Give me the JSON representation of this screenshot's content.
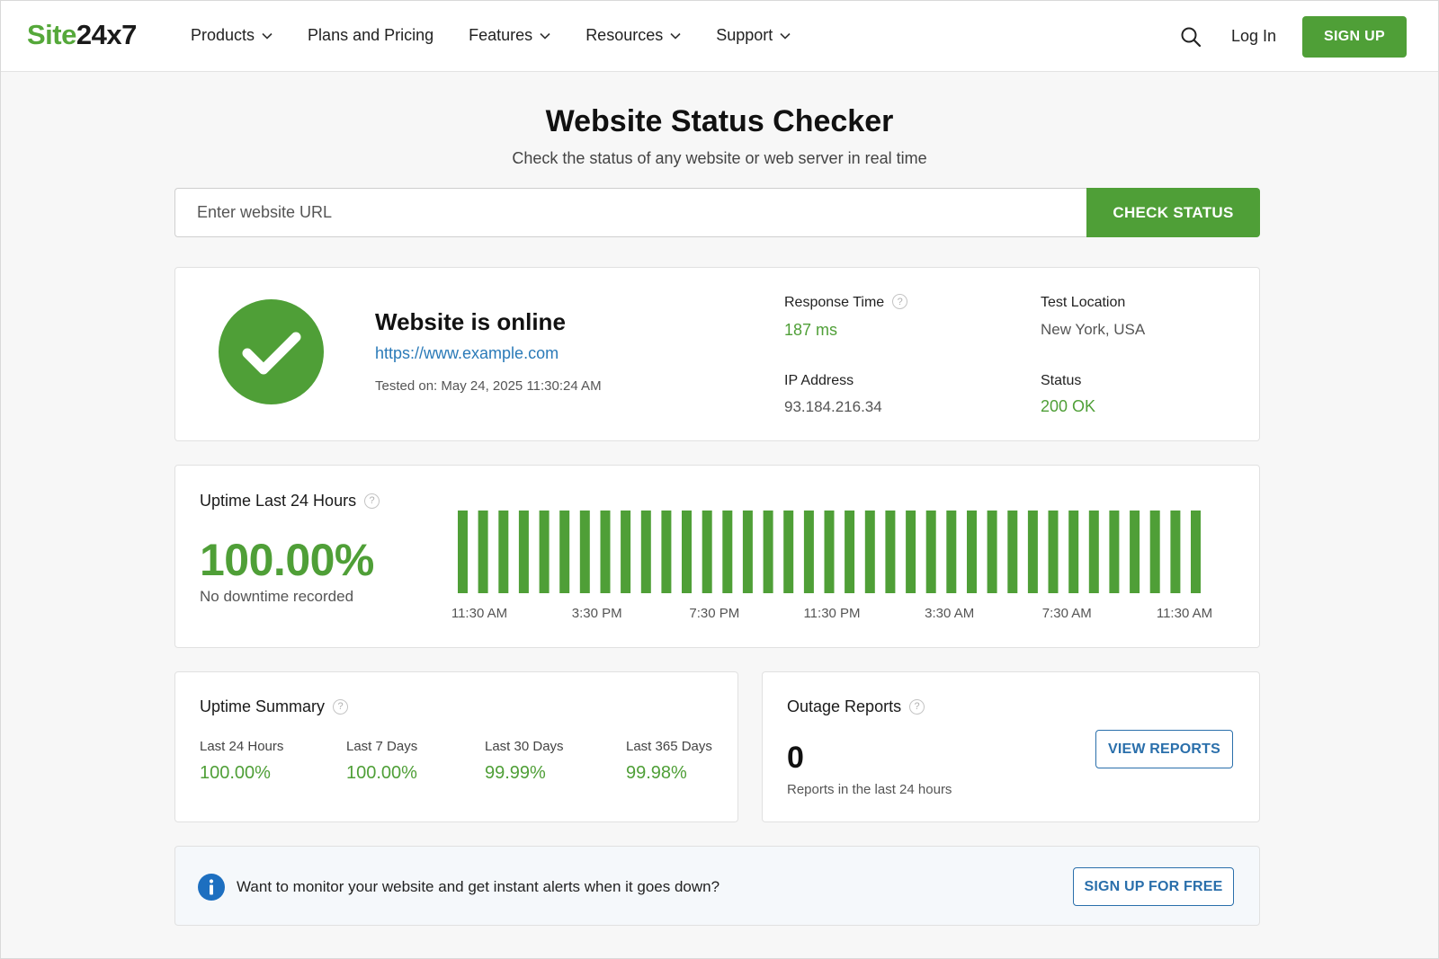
{
  "brand": {
    "logo_part1": "Site",
    "logo_part2": "24x7",
    "accent_color": "#4f9f37",
    "link_color": "#2a7ab8"
  },
  "nav": {
    "items": [
      {
        "label": "Products",
        "has_dropdown": true
      },
      {
        "label": "Plans and Pricing",
        "has_dropdown": false
      },
      {
        "label": "Features",
        "has_dropdown": true
      },
      {
        "label": "Resources",
        "has_dropdown": true
      },
      {
        "label": "Support",
        "has_dropdown": true
      }
    ],
    "search_icon": "search-icon",
    "login_label": "Log In",
    "signup_label": "SIGN UP"
  },
  "hero": {
    "title": "Website Status Checker",
    "subtitle": "Check the status of any website or web server in real time",
    "input_placeholder": "Enter website URL",
    "input_value": "",
    "button_label": "CHECK STATUS"
  },
  "status": {
    "icon": "check-circle-icon",
    "title": "Website is online",
    "url": "https://www.example.com",
    "tested_on": "Tested on: May 24, 2025 11:30:24 AM",
    "response_time_label": "Response Time",
    "response_time_value": "187 ms",
    "test_location_label": "Test Location",
    "test_location_value": "New York, USA",
    "ip_label": "IP Address",
    "ip_value": "93.184.216.34",
    "status_label": "Status",
    "status_value": "200 OK"
  },
  "uptime24": {
    "title": "Uptime Last 24 Hours",
    "percentage": "100.00%",
    "note": "No downtime recorded",
    "bar_count": 37,
    "bar_values": [
      1,
      1,
      1,
      1,
      1,
      1,
      1,
      1,
      1,
      1,
      1,
      1,
      1,
      1,
      1,
      1,
      1,
      1,
      1,
      1,
      1,
      1,
      1,
      1,
      1,
      1,
      1,
      1,
      1,
      1,
      1,
      1,
      1,
      1,
      1,
      1,
      1
    ],
    "time_labels": [
      "11:30 AM",
      "3:30 PM",
      "7:30 PM",
      "11:30 PM",
      "3:30 AM",
      "7:30 AM",
      "11:30 AM"
    ],
    "bar_color": "#4f9f37"
  },
  "summary": {
    "title": "Uptime Summary",
    "periods": [
      {
        "label": "Last 24 Hours",
        "value": "100.00%"
      },
      {
        "label": "Last 7 Days",
        "value": "100.00%"
      },
      {
        "label": "Last 30 Days",
        "value": "99.99%"
      },
      {
        "label": "Last 365 Days",
        "value": "99.98%"
      }
    ]
  },
  "outages": {
    "title": "Outage Reports",
    "count": "0",
    "note": "Reports in the last 24 hours",
    "button_label": "VIEW REPORTS"
  },
  "cta": {
    "icon": "info-icon",
    "text": "Want to monitor your website and get instant alerts when it goes down?",
    "button_label": "SIGN UP FOR FREE"
  }
}
